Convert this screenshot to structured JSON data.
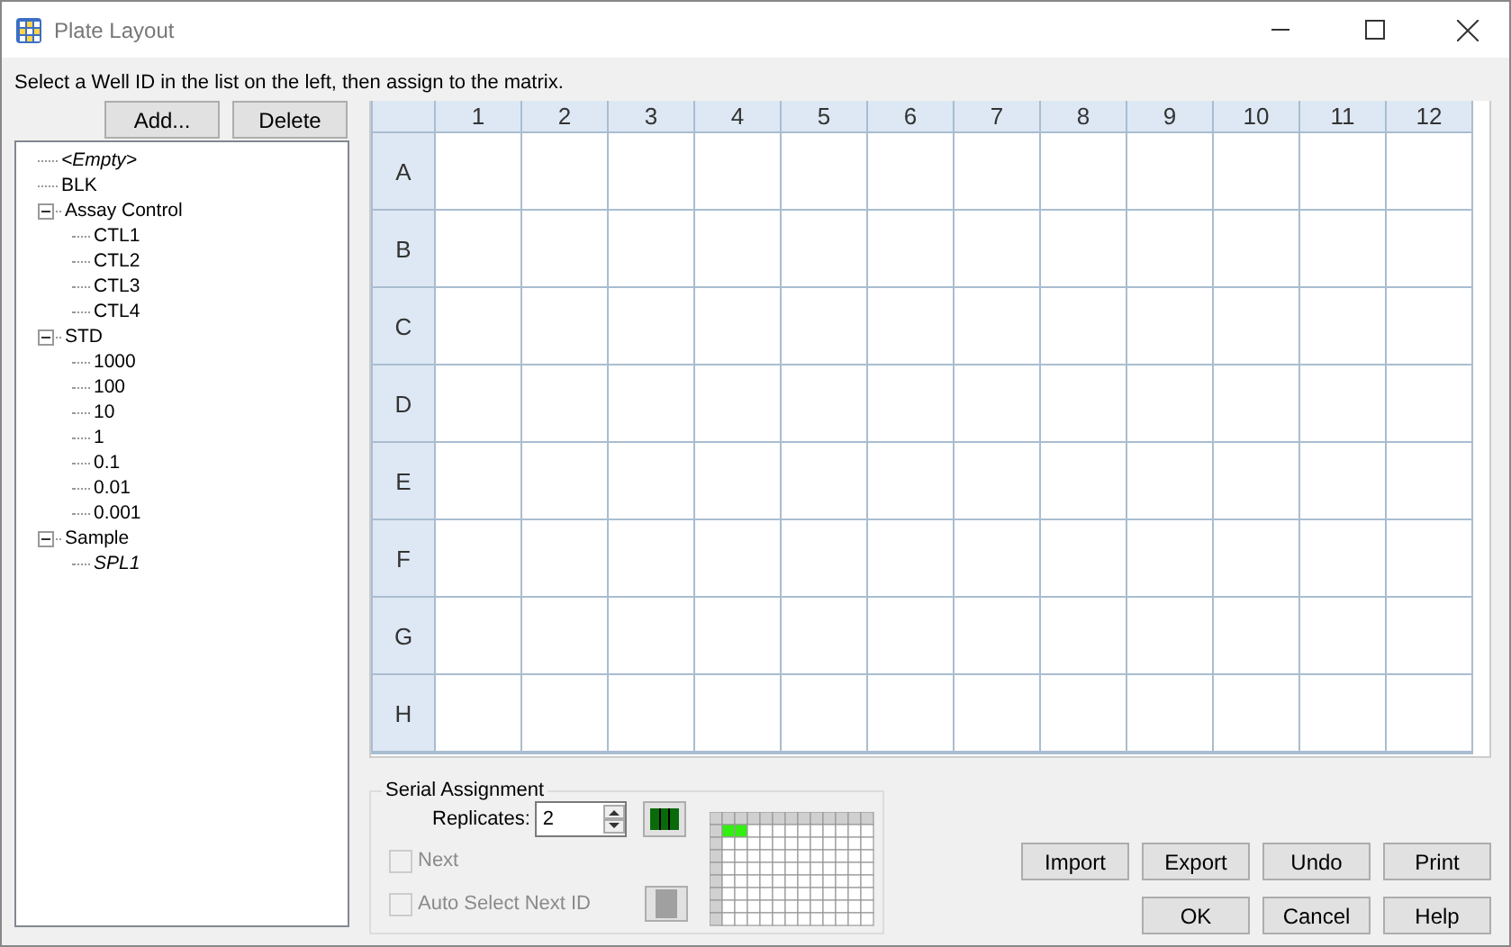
{
  "window": {
    "title": "Plate Layout"
  },
  "instruction": "Select a Well ID in the list on the left, then assign to the matrix.",
  "list_buttons": [
    "Add...",
    "Delete"
  ],
  "tree": [
    {
      "label": "<Empty>",
      "emphasized": true
    },
    {
      "label": "BLK",
      "emphasized": false
    },
    {
      "label": "Assay Control",
      "emphasized": false,
      "expanded": true,
      "children": [
        {
          "label": "CTL1",
          "emphasized": false
        },
        {
          "label": "CTL2",
          "emphasized": false
        },
        {
          "label": "CTL3",
          "emphasized": false
        },
        {
          "label": "CTL4",
          "emphasized": false
        }
      ]
    },
    {
      "label": "STD",
      "emphasized": false,
      "expanded": true,
      "children": [
        {
          "label": "1000",
          "emphasized": false
        },
        {
          "label": "100",
          "emphasized": false
        },
        {
          "label": "10",
          "emphasized": false
        },
        {
          "label": "1",
          "emphasized": false
        },
        {
          "label": "0.1",
          "emphasized": false
        },
        {
          "label": "0.01",
          "emphasized": false
        },
        {
          "label": "0.001",
          "emphasized": false
        }
      ]
    },
    {
      "label": "Sample",
      "emphasized": false,
      "expanded": true,
      "children": [
        {
          "label": "SPL1",
          "emphasized": true
        }
      ]
    }
  ],
  "plate": {
    "columns": [
      "1",
      "2",
      "3",
      "4",
      "5",
      "6",
      "7",
      "8",
      "9",
      "10",
      "11",
      "12"
    ],
    "rows": [
      "A",
      "B",
      "C",
      "D",
      "E",
      "F",
      "G",
      "H"
    ]
  },
  "serial_assignment": {
    "title": "Serial Assignment",
    "replicates_label": "Replicates:",
    "replicates": "2",
    "checkboxes": [
      {
        "label": "Next",
        "checked": false,
        "disabled": true
      },
      {
        "label": "Auto Select Next ID",
        "checked": false,
        "disabled": true
      }
    ]
  },
  "action_buttons": [
    "Import",
    "Export",
    "Undo",
    "Print"
  ],
  "dialog_buttons": [
    "OK",
    "Cancel",
    "Help"
  ]
}
